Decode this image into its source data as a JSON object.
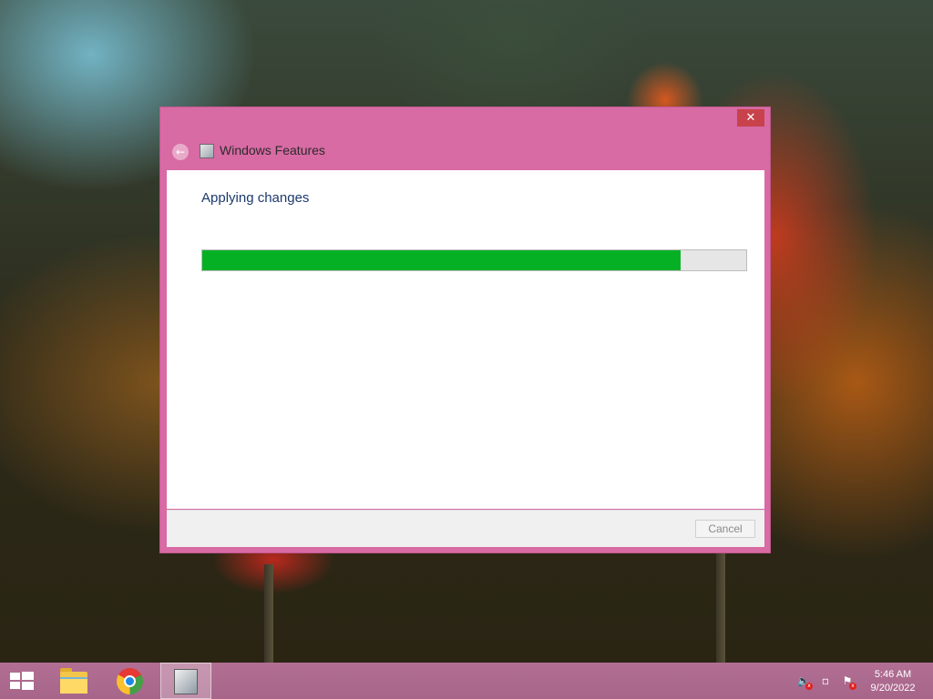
{
  "dialog": {
    "title": "Windows Features",
    "heading": "Applying changes",
    "progress_percent": 88,
    "cancel_label": "Cancel",
    "close_glyph": "✕",
    "back_glyph": "←",
    "icons": [
      "back-arrow-icon",
      "windows-features-icon"
    ]
  },
  "taskbar": {
    "pinned": [
      "start-button",
      "file-explorer",
      "google-chrome",
      "windows-features"
    ],
    "tray_icons": [
      "speaker-muted-icon",
      "network-disconnected-icon",
      "action-center-flag-icon"
    ],
    "time": "5:46 AM",
    "date": "9/20/2022"
  },
  "colors": {
    "window_accent": "#d86aa4",
    "progress_fill": "#06b025",
    "taskbar": "#ab688e"
  }
}
